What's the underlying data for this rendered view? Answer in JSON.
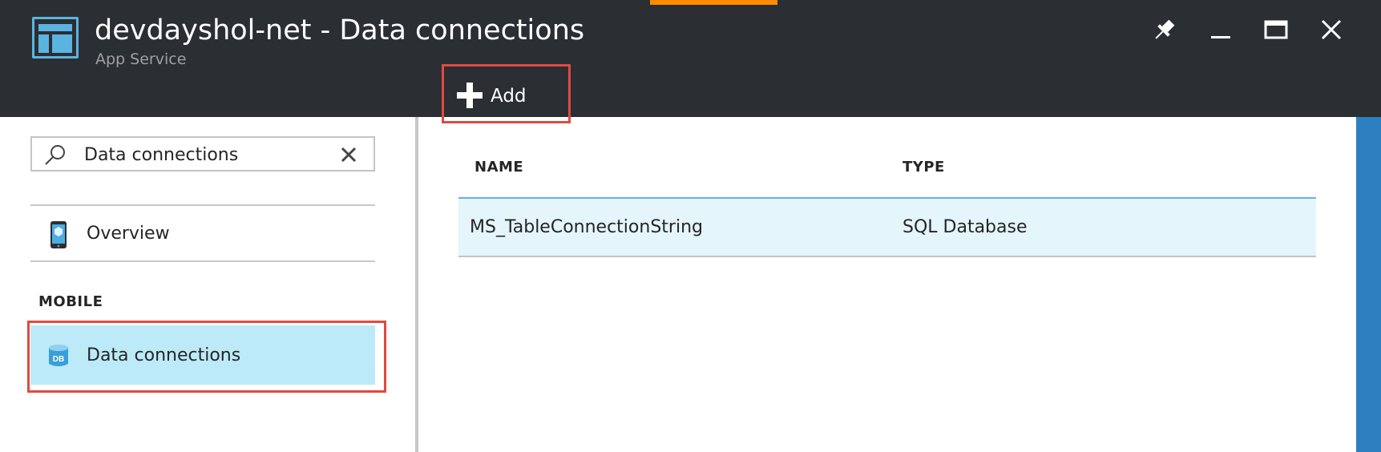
{
  "header": {
    "title": "devdayshol-net - Data connections",
    "subtitle": "App Service",
    "toolbar": {
      "add_label": "Add"
    },
    "window_controls": [
      "pin-icon",
      "minimize-icon",
      "maximize-icon",
      "close-icon"
    ]
  },
  "sidebar": {
    "search": {
      "value": "Data connections",
      "placeholder": ""
    },
    "items": [
      {
        "label": "Overview",
        "icon": "mobile-phone-icon"
      }
    ],
    "sections": [
      {
        "title": "MOBILE",
        "items": [
          {
            "label": "Data connections",
            "icon": "database-icon",
            "selected": true
          }
        ]
      }
    ]
  },
  "table": {
    "columns": [
      "NAME",
      "TYPE"
    ],
    "rows": [
      {
        "name": "MS_TableConnectionString",
        "type": "SQL Database"
      }
    ]
  },
  "colors": {
    "header_bg": "#2b2e33",
    "accent_orange": "#ff8c00",
    "accent_blue": "#5ab4e0",
    "selected_bg": "#bdeaf8",
    "row_bg": "#e4f5fb",
    "highlight_red": "#e04a3f"
  }
}
